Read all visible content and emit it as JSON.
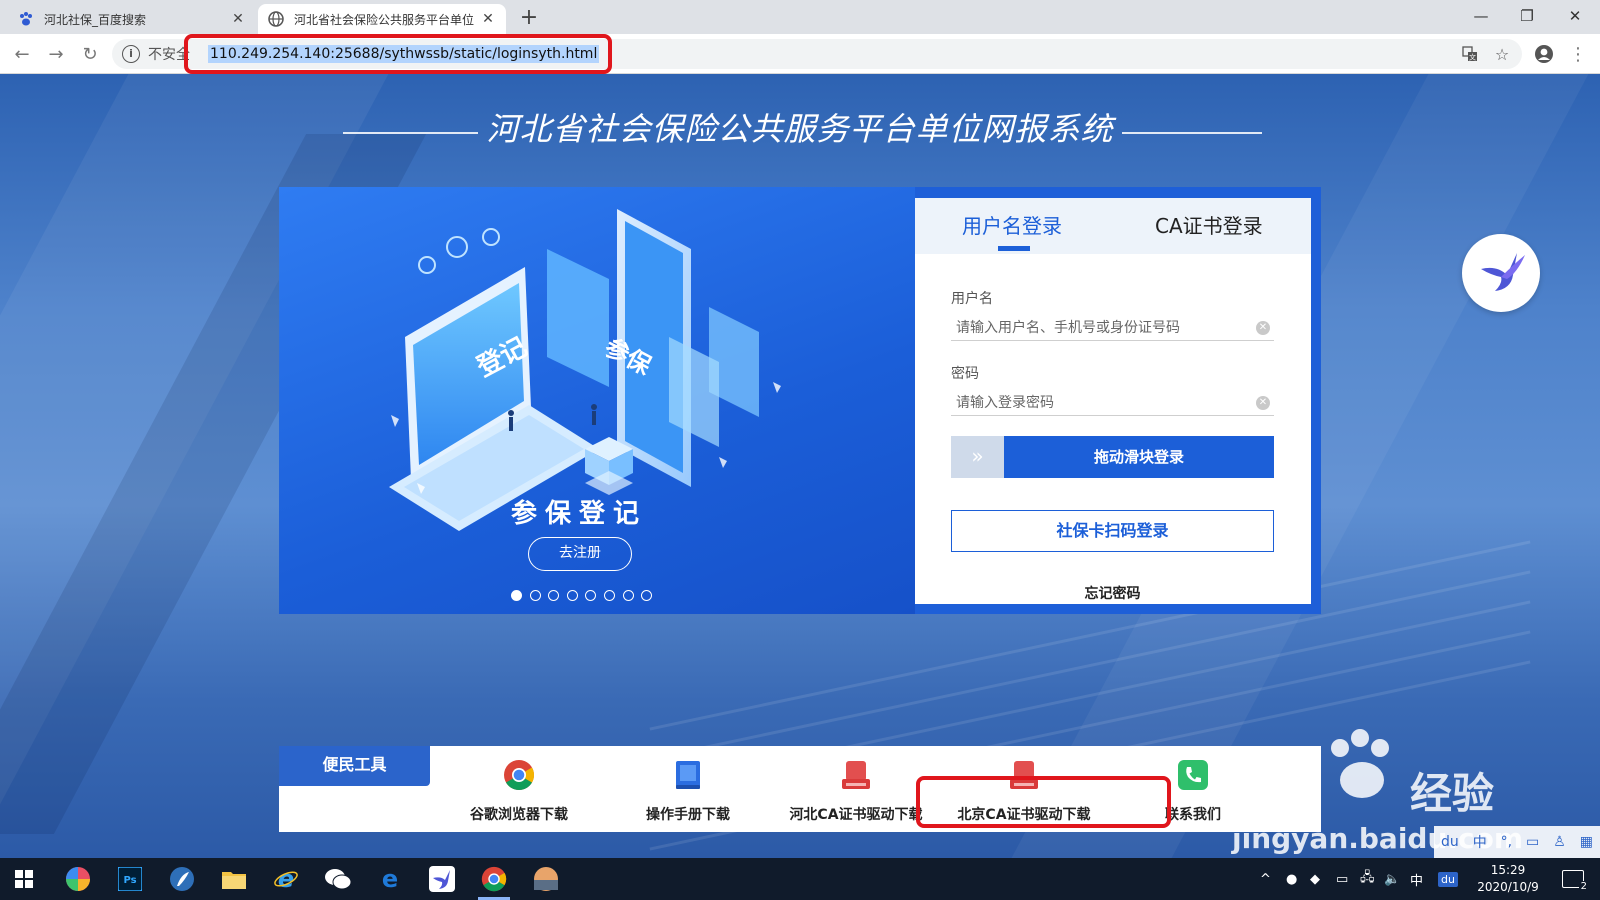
{
  "browser": {
    "tabs": [
      {
        "title": "河北社保_百度搜索",
        "active": false
      },
      {
        "title": "河北省社会保险公共服务平台单位",
        "active": true
      }
    ],
    "insecure_label": "不安全",
    "url": "110.249.254.140:25688/sythwssb/static/loginsyth.html",
    "highlight_color": "#e0161c"
  },
  "page": {
    "title": "河北省社会保险公共服务平台单位网报系统",
    "banner": {
      "caption": "参保登记",
      "register_button": "去注册",
      "image_text_1": "登记",
      "image_text_2": "参保",
      "slide_count": 8,
      "active_slide": 1
    },
    "login": {
      "tab_username": "用户名登录",
      "tab_ca": "CA证书登录",
      "username_label": "用户名",
      "username_placeholder": "请输入用户名、手机号或身份证号码",
      "password_label": "密码",
      "password_placeholder": "请输入登录密码",
      "slider_text": "拖动滑块登录",
      "card_login": "社保卡扫码登录",
      "forgot": "忘记密码"
    },
    "tools": {
      "tag": "便民工具",
      "items": [
        {
          "label": "谷歌浏览器下载",
          "icon": "chrome-icon"
        },
        {
          "label": "操作手册下载",
          "icon": "manual-icon"
        },
        {
          "label": "河北CA证书驱动下载",
          "icon": "usb-key-icon"
        },
        {
          "label": "北京CA证书驱动下载",
          "icon": "usb-key-icon"
        },
        {
          "label": "联系我们",
          "icon": "phone-icon"
        }
      ]
    },
    "accent": "#1c5fd8"
  },
  "watermark": {
    "brand": "Bai",
    "suffix": "经验",
    "site": "jingyan.baidu.com"
  },
  "taskbar": {
    "time": "15:29",
    "date": "2020/10/9",
    "ime": "中",
    "notifications": "2"
  }
}
